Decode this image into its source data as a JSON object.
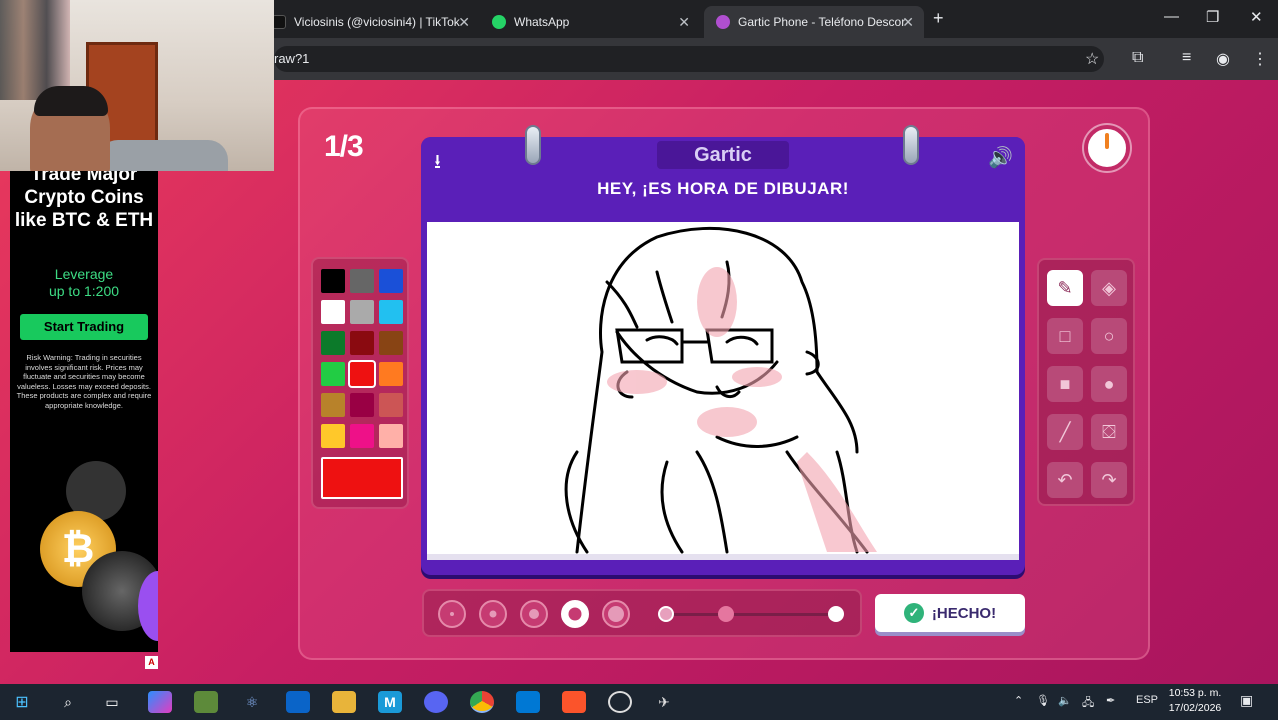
{
  "browser": {
    "tabs": [
      {
        "title": "Viciosinis (@viciosini4) | TikTok",
        "favicon": "tiktok-icon"
      },
      {
        "title": "WhatsApp",
        "favicon": "whatsapp-icon"
      },
      {
        "title": "Gartic Phone - Teléfono Descor",
        "favicon": "gartic-icon"
      }
    ],
    "new_tab": "+",
    "url": "raw?1"
  },
  "game": {
    "round": "1/3",
    "logo": "Gartic",
    "banner": "HEY, ¡ES HORA DE DIBUJAR!",
    "done_label": "¡HECHO!",
    "palette": [
      "#000000",
      "#666666",
      "#1a50d8",
      "#ffffff",
      "#aaaaaa",
      "#22c0f0",
      "#0c7a2a",
      "#8a0a10",
      "#884414",
      "#22cc44",
      "#ee1111",
      "#ff7a20",
      "#b8822a",
      "#990044",
      "#cc5555",
      "#ffc82a",
      "#ee1188",
      "#ffb0a8"
    ],
    "selected_color": "#ee1111",
    "brush_sizes": 5,
    "selected_size_index": 3,
    "opacity_level": 0.35,
    "tools": [
      "pencil-icon",
      "eraser-icon",
      "rectangle-outline-icon",
      "circle-outline-icon",
      "rectangle-fill-icon",
      "circle-fill-icon",
      "line-icon",
      "bucket-icon",
      "undo-icon",
      "redo-icon"
    ]
  },
  "ad": {
    "title": "Trade Major Crypto Coins like BTC & ETH",
    "subtitle_1": "Leverage",
    "subtitle_2": "up to 1:200",
    "button": "Start Trading",
    "warning": "Risk Warning: Trading in securities involves significant risk. Prices may fluctuate and securities may become valueless. Losses may exceed deposits. These products are complex and require appropriate knowledge.",
    "badge": "A"
  },
  "taskbar": {
    "language": "ESP",
    "time": "10:53 p. m.",
    "date": "17/02/2026"
  }
}
